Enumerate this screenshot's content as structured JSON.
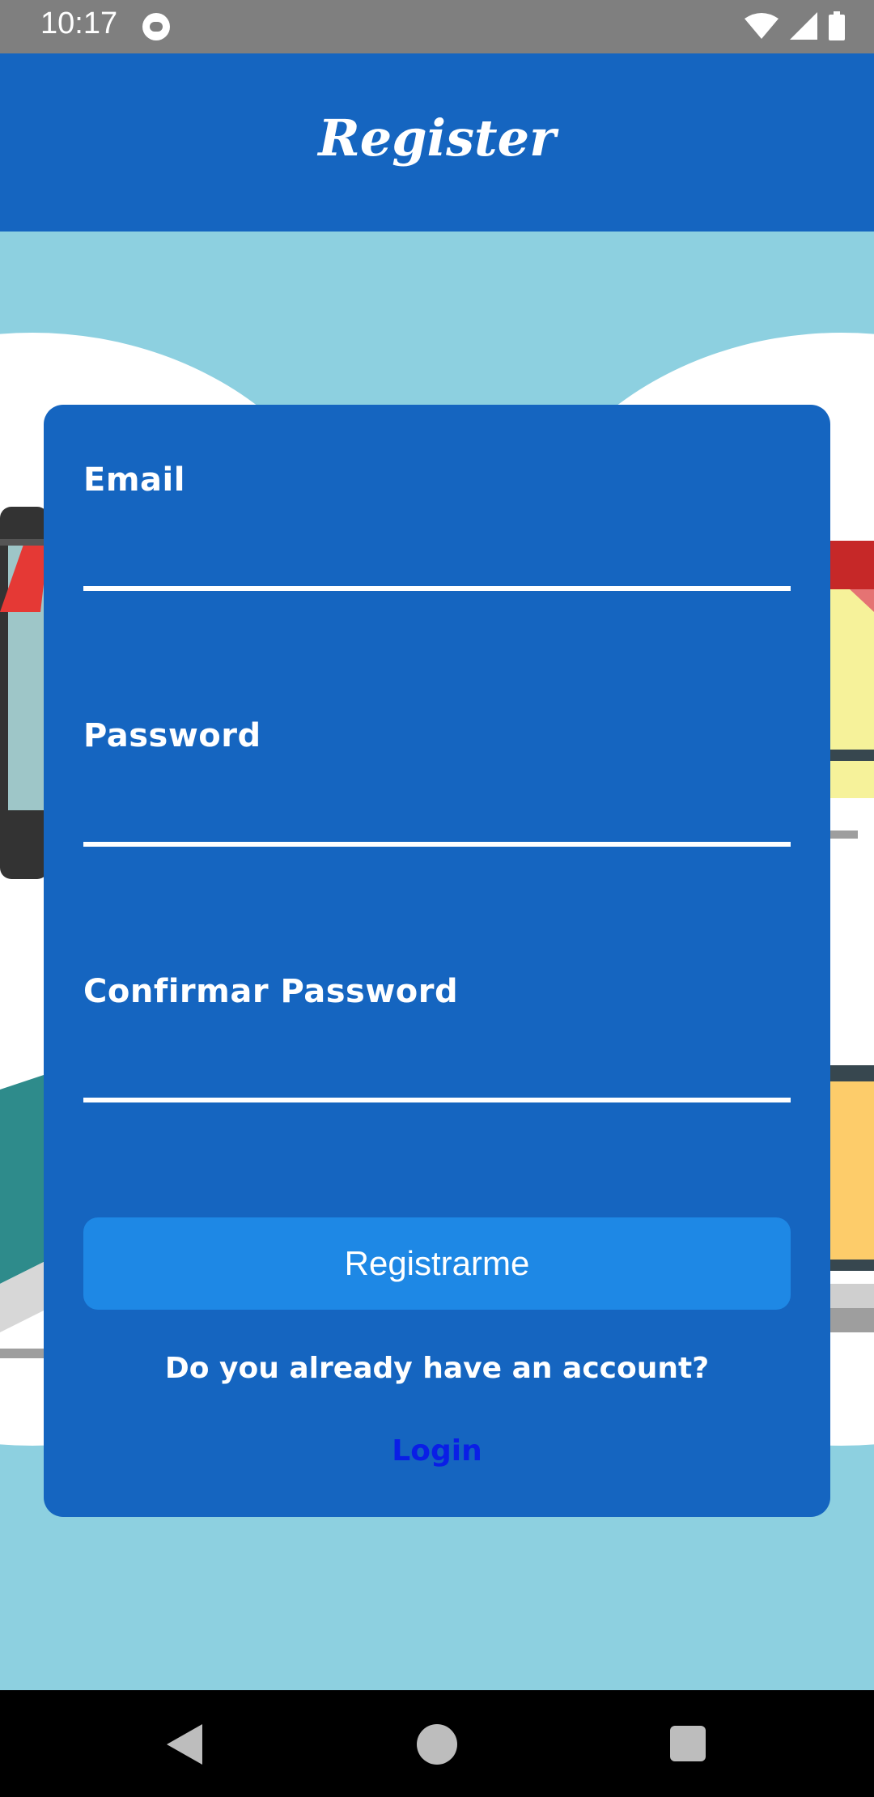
{
  "status_bar": {
    "time": "10:17",
    "icons": [
      "app-notification-icon",
      "wifi-icon",
      "signal-icon",
      "battery-icon"
    ]
  },
  "app_bar": {
    "title": "Register"
  },
  "form": {
    "email_label": "Email",
    "email_value": "",
    "password_label": "Password",
    "password_value": "",
    "confirm_label": "Confirmar Password",
    "confirm_value": "",
    "submit_label": "Registrarme",
    "account_question": "Do you already have an account?",
    "login_link": "Login"
  },
  "nav_bar": {
    "icons": [
      "back-icon",
      "home-icon",
      "recents-icon"
    ]
  },
  "colors": {
    "status_bar": "#7f7f7f",
    "primary": "#1565c0",
    "button": "#1e88e5",
    "background": "#8dd0e0",
    "link": "#0a1ee6"
  }
}
